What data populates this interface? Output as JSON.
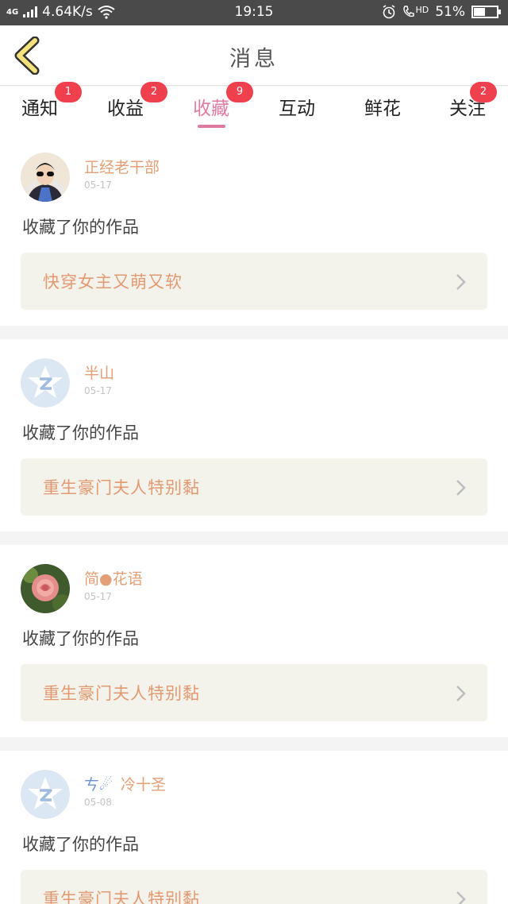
{
  "status_bar": {
    "network": "4G",
    "speed": "4.64K/s",
    "time": "19:15",
    "hd": "HD",
    "battery": "51%",
    "battery_level": 0.51
  },
  "header": {
    "title": "消息"
  },
  "tabs": [
    {
      "label": "通知",
      "badge": "1",
      "active": false
    },
    {
      "label": "收益",
      "badge": "2",
      "active": false
    },
    {
      "label": "收藏",
      "badge": "9",
      "active": true
    },
    {
      "label": "互动",
      "badge": "",
      "active": false
    },
    {
      "label": "鲜花",
      "badge": "",
      "active": false
    },
    {
      "label": "关注",
      "badge": "2",
      "active": false
    }
  ],
  "items": [
    {
      "user": "正经老干部",
      "date": "05-17",
      "action": "收藏了你的作品",
      "work": "快穿女主又萌又软",
      "avatar": "photo-boy"
    },
    {
      "user": "半山",
      "date": "05-17",
      "action": "收藏了你的作品",
      "work": "重生豪门夫人特别黏",
      "avatar": "default-z"
    },
    {
      "user": "简●花语",
      "date": "05-17",
      "action": "收藏了你的作品",
      "work": "重生豪门夫人特别黏",
      "avatar": "photo-rose"
    },
    {
      "user": "冷十圣",
      "date": "05-08",
      "action": "收藏了你的作品",
      "work": "重生豪门夫人特别黏",
      "avatar": "default-z",
      "prefix": "ㄘ☄"
    }
  ],
  "colors": {
    "accent": "#e07aa3",
    "badge": "#f0404e",
    "name": "#e3a077",
    "work_title": "#e39970"
  }
}
